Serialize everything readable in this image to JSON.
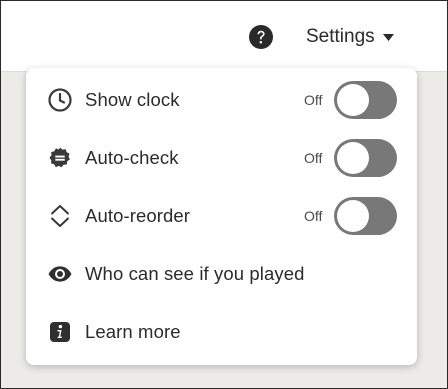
{
  "header": {
    "help_icon": "question-circle-icon",
    "settings_label": "Settings",
    "settings_caret_icon": "caret-down-icon"
  },
  "menu": {
    "items": [
      {
        "label": "Show clock",
        "icon": "clock-icon",
        "toggle": true,
        "state": "Off",
        "on": false
      },
      {
        "label": "Auto-check",
        "icon": "badge-check-icon",
        "toggle": true,
        "state": "Off",
        "on": false
      },
      {
        "label": "Auto-reorder",
        "icon": "reorder-chevrons-icon",
        "toggle": true,
        "state": "Off",
        "on": false
      },
      {
        "label": "Who can see if you played",
        "icon": "eye-icon",
        "toggle": false
      },
      {
        "label": "Learn more",
        "icon": "info-icon",
        "toggle": false
      }
    ]
  },
  "colors": {
    "toggle_off": "#787878",
    "icon": "#3a3a3a",
    "background": "#ecebe8"
  }
}
